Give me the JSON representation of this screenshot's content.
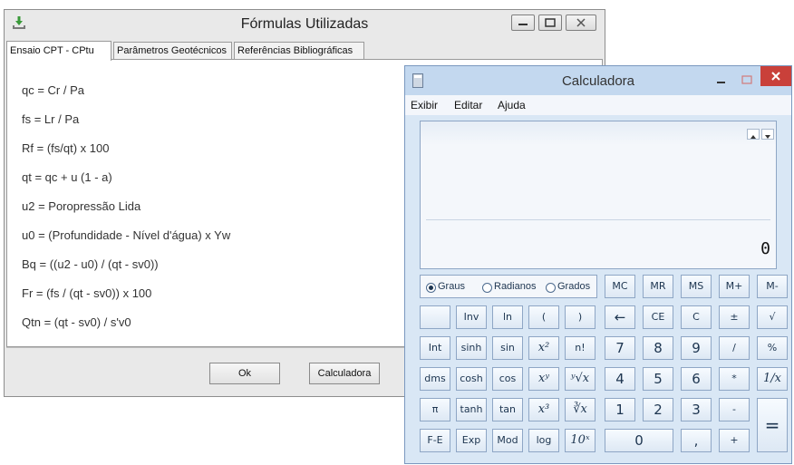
{
  "formulas_window": {
    "title": "Fórmulas Utilizadas",
    "tabs": [
      {
        "label": "Ensaio CPT - CPtu",
        "active": true
      },
      {
        "label": "Parâmetros Geotécnicos",
        "active": false
      },
      {
        "label": "Referências Bibliográficas",
        "active": false
      }
    ],
    "formulas": [
      "qc = Cr / Pa",
      "fs = Lr / Pa",
      "Rf = (fs/qt) x 100",
      "qt = qc + u (1 - a)",
      "u2 = Poropressão Lida",
      "u0 = (Profundidade - Nível d'água) x Yw",
      "Bq = ((u2 - u0) / (qt - sv0))",
      "Fr = (fs / (qt - sv0)) x 100",
      "Qtn = (qt - sv0) / s'v0"
    ],
    "ok_label": "Ok",
    "calc_label": "Calculadora"
  },
  "calculator": {
    "title": "Calculadora",
    "menu": [
      "Exibir",
      "Editar",
      "Ajuda"
    ],
    "display_value": "0",
    "angle_modes": [
      {
        "label": "Graus",
        "selected": true
      },
      {
        "label": "Radianos",
        "selected": false
      },
      {
        "label": "Grados",
        "selected": false
      }
    ],
    "memory_keys": [
      "MC",
      "MR",
      "MS",
      "M+",
      "M-"
    ],
    "row2": [
      "",
      "Inv",
      "ln",
      "(",
      ")",
      "←",
      "CE",
      "C",
      "±",
      "√"
    ],
    "row3": [
      "Int",
      "sinh",
      "sin",
      "x²",
      "n!",
      "7",
      "8",
      "9",
      "/",
      "%"
    ],
    "row4": [
      "dms",
      "cosh",
      "cos",
      "xʸ",
      "ʸ√x",
      "4",
      "5",
      "6",
      "*",
      "1/x"
    ],
    "row5": [
      "π",
      "tanh",
      "tan",
      "x³",
      "∛x",
      "1",
      "2",
      "3",
      "-",
      "="
    ],
    "row6": [
      "F-E",
      "Exp",
      "Mod",
      "log",
      "10ˣ",
      "0",
      ",",
      "+"
    ]
  },
  "colors": {
    "calc_bg": "#d9e7f5",
    "close_button": "#c9403a"
  }
}
